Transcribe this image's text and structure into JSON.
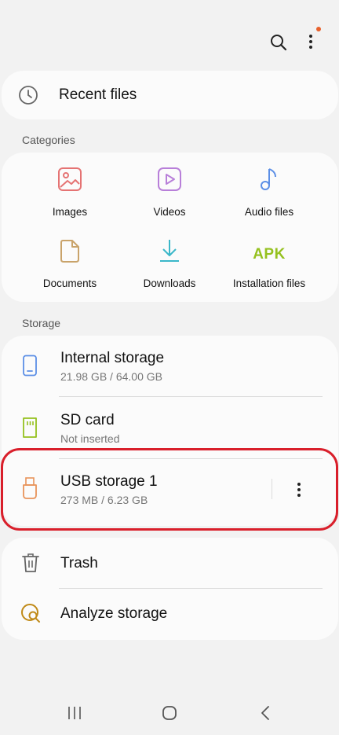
{
  "header": {
    "search_icon": "search-icon",
    "more_icon": "more-vert-icon",
    "notification_dot_color": "#e8612c"
  },
  "recent": {
    "label": "Recent files"
  },
  "categories": {
    "heading": "Categories",
    "items": [
      {
        "label": "Images",
        "icon": "images-icon",
        "color": "#e57373"
      },
      {
        "label": "Videos",
        "icon": "videos-icon",
        "color": "#b87fd9"
      },
      {
        "label": "Audio files",
        "icon": "audio-icon",
        "color": "#5c8fe6"
      },
      {
        "label": "Documents",
        "icon": "documents-icon",
        "color": "#c9a36a"
      },
      {
        "label": "Downloads",
        "icon": "downloads-icon",
        "color": "#3bb7c9"
      },
      {
        "label": "Installation files",
        "icon": "apk-icon",
        "icon_text": "APK",
        "color": "#95c11f"
      }
    ]
  },
  "storage": {
    "heading": "Storage",
    "items": [
      {
        "title": "Internal storage",
        "subtitle": "21.98 GB / 64.00 GB",
        "icon": "phone-icon"
      },
      {
        "title": "SD card",
        "subtitle": "Not inserted",
        "icon": "sd-card-icon"
      },
      {
        "title": "USB storage 1",
        "subtitle": "273 MB / 6.23 GB",
        "icon": "usb-icon"
      }
    ],
    "highlight_color": "#d91f2b"
  },
  "tools": {
    "items": [
      {
        "title": "Trash",
        "icon": "trash-icon"
      },
      {
        "title": "Analyze storage",
        "icon": "analyze-storage-icon"
      }
    ]
  },
  "navbar": {
    "recents": "recents-icon",
    "home": "home-icon",
    "back": "back-icon"
  }
}
